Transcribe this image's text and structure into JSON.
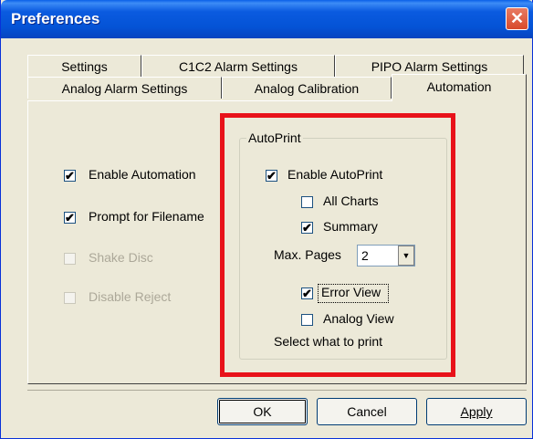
{
  "window": {
    "title": "Preferences",
    "close_glyph": "✕"
  },
  "tabs": {
    "row_back": [
      "Settings",
      "C1C2 Alarm Settings",
      "PIPO Alarm Settings"
    ],
    "row_front": [
      "Analog Alarm Settings",
      "Analog Calibration",
      "Automation"
    ],
    "active": "Automation"
  },
  "left_options": [
    {
      "label": "Enable Automation",
      "checked": true,
      "enabled": true
    },
    {
      "label": "Prompt for Filename",
      "checked": true,
      "enabled": true
    },
    {
      "label": "Shake Disc",
      "checked": false,
      "enabled": false
    },
    {
      "label": "Disable Reject",
      "checked": false,
      "enabled": false
    }
  ],
  "autoprint": {
    "group_title": "AutoPrint",
    "enable_label": "Enable AutoPrint",
    "enable_checked": true,
    "all_charts_label": "All Charts",
    "all_charts_checked": false,
    "summary_label": "Summary",
    "summary_checked": true,
    "max_pages_label": "Max. Pages",
    "max_pages_value": "2",
    "dropdown_glyph": "▼",
    "error_view_label": "Error View",
    "error_view_checked": true,
    "analog_view_label": "Analog View",
    "analog_view_checked": false,
    "hint": "Select what to print"
  },
  "check_glyph": "✔",
  "highlight_color": "#E8121A",
  "buttons": {
    "ok": "OK",
    "cancel": "Cancel",
    "apply": "Apply"
  }
}
